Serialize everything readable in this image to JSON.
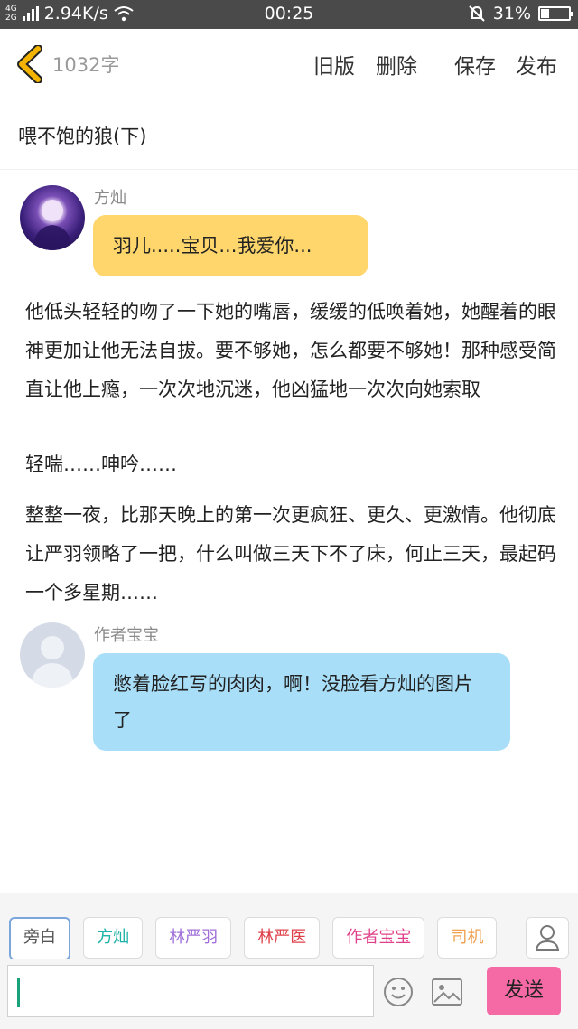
{
  "status_bar": {
    "network_top": "4G",
    "network_bottom": "2G",
    "speed": "2.94K/s",
    "time": "00:25",
    "battery_percent": "31%",
    "battery_level": 0.31
  },
  "header": {
    "word_count": "1032字",
    "old_version": "旧版",
    "delete": "删除",
    "save": "保存",
    "publish": "发布"
  },
  "story": {
    "title": "喂不饱的狼(下)"
  },
  "messages": [
    {
      "speaker": "方灿",
      "text": "羽儿.....宝贝...我爱你..."
    }
  ],
  "narration": [
    "他低头轻轻的吻了一下她的嘴唇，缓缓的低唤着她，她醒着的眼神更加让他无法自拔。要不够她，怎么都要不够她！那种感受简直让他上瘾，一次次地沉迷，他凶猛地一次次向她索取",
    "轻喘……呻吟……",
    "整整一夜，比那天晚上的第一次更疯狂、更久、更激情。他彻底让严羽领略了一把，什么叫做三天下不了床，何止三天，最起码一个多星期……"
  ],
  "author_note": {
    "speaker": "作者宝宝",
    "text": "憋着脸红写的肉肉，啊！没脸看方灿的图片了"
  },
  "roles": [
    {
      "label": "旁白",
      "color": "#555555"
    },
    {
      "label": "方灿",
      "color": "#1fb3a8"
    },
    {
      "label": "林严羽",
      "color": "#a070d8"
    },
    {
      "label": "林严医",
      "color": "#e0404a"
    },
    {
      "label": "作者宝宝",
      "color": "#e0408a"
    },
    {
      "label": "司机",
      "color": "#f0a050"
    }
  ],
  "input": {
    "placeholder": ""
  },
  "send_label": "发送",
  "icons": {
    "back": "back-chevron-icon",
    "wifi": "wifi-icon",
    "mute": "bell-off-icon",
    "person": "person-icon",
    "emoji": "smiley-icon",
    "image": "image-icon"
  },
  "colors": {
    "accent_yellow": "#ffd66b",
    "accent_blue": "#a8def8",
    "send_pink": "#f56aa4",
    "back_chevron": "#f2b400"
  }
}
